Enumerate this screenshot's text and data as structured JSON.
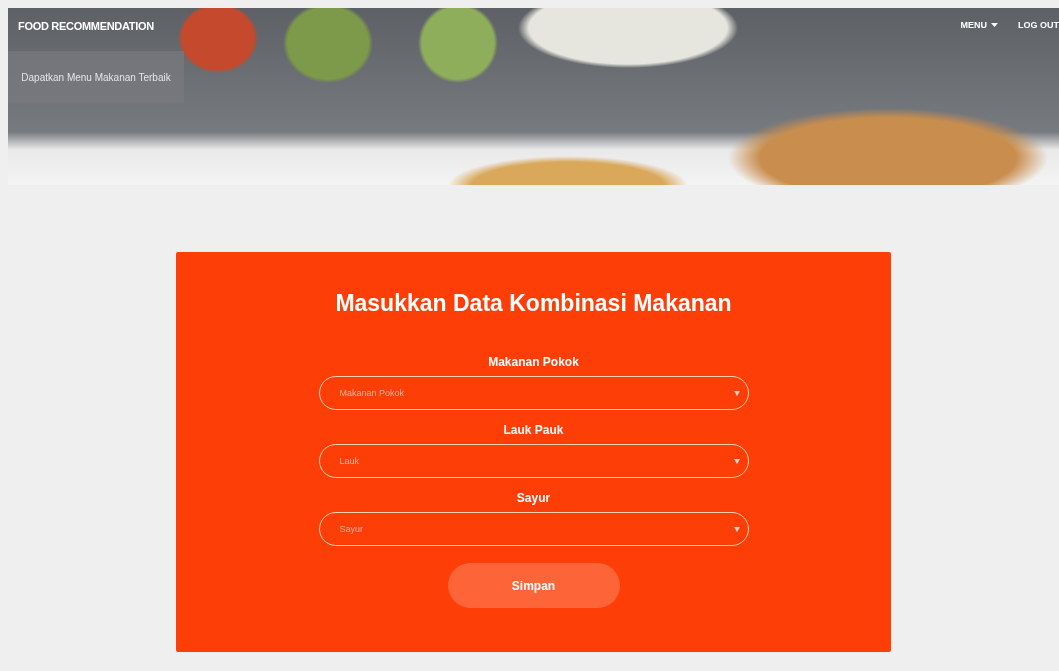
{
  "navbar": {
    "brand": "FOOD RECOMMENDATION",
    "tagline": "Dapatkan Menu Makanan Terbaik",
    "menu": "MENU",
    "logout": "LOG OUT"
  },
  "form": {
    "title": "Masukkan Data Kombinasi Makanan",
    "fields": [
      {
        "label": "Makanan Pokok",
        "placeholder": "Makanan Pokok"
      },
      {
        "label": "Lauk Pauk",
        "placeholder": "Lauk"
      },
      {
        "label": "Sayur",
        "placeholder": "Sayur"
      }
    ],
    "submit": "Simpan"
  }
}
